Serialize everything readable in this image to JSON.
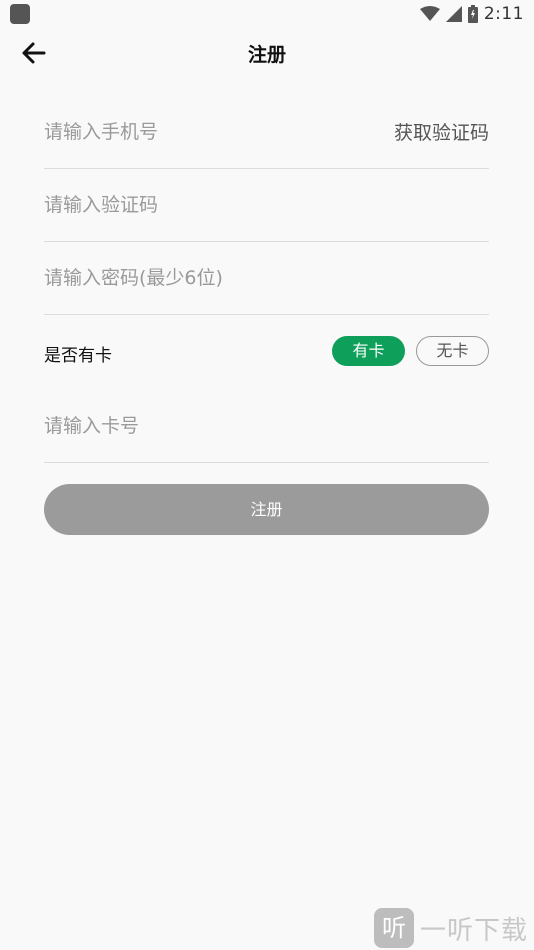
{
  "status_bar": {
    "time": "2:11",
    "icons": [
      "app-notification-icon",
      "wifi-icon",
      "signal-icon",
      "battery-icon"
    ]
  },
  "app_bar": {
    "title": "注册",
    "back_icon": "arrow-left-icon"
  },
  "form": {
    "phone": {
      "value": "",
      "placeholder": "请输入手机号"
    },
    "get_code_label": "获取验证码",
    "code": {
      "value": "",
      "placeholder": "请输入验证码"
    },
    "password": {
      "value": "",
      "placeholder": "请输入密码(最少6位)"
    },
    "has_card": {
      "label": "是否有卡",
      "yes_label": "有卡",
      "no_label": "无卡",
      "selected": "有卡"
    },
    "card_number": {
      "value": "",
      "placeholder": "请输入卡号"
    },
    "submit_label": "注册"
  },
  "watermark": {
    "logo_char": "听",
    "text": "一听下载"
  },
  "colors": {
    "accent": "#0ea05a",
    "submit_disabled": "#9b9b9b",
    "background": "#f9f9f9",
    "placeholder": "#9a9a9a"
  }
}
